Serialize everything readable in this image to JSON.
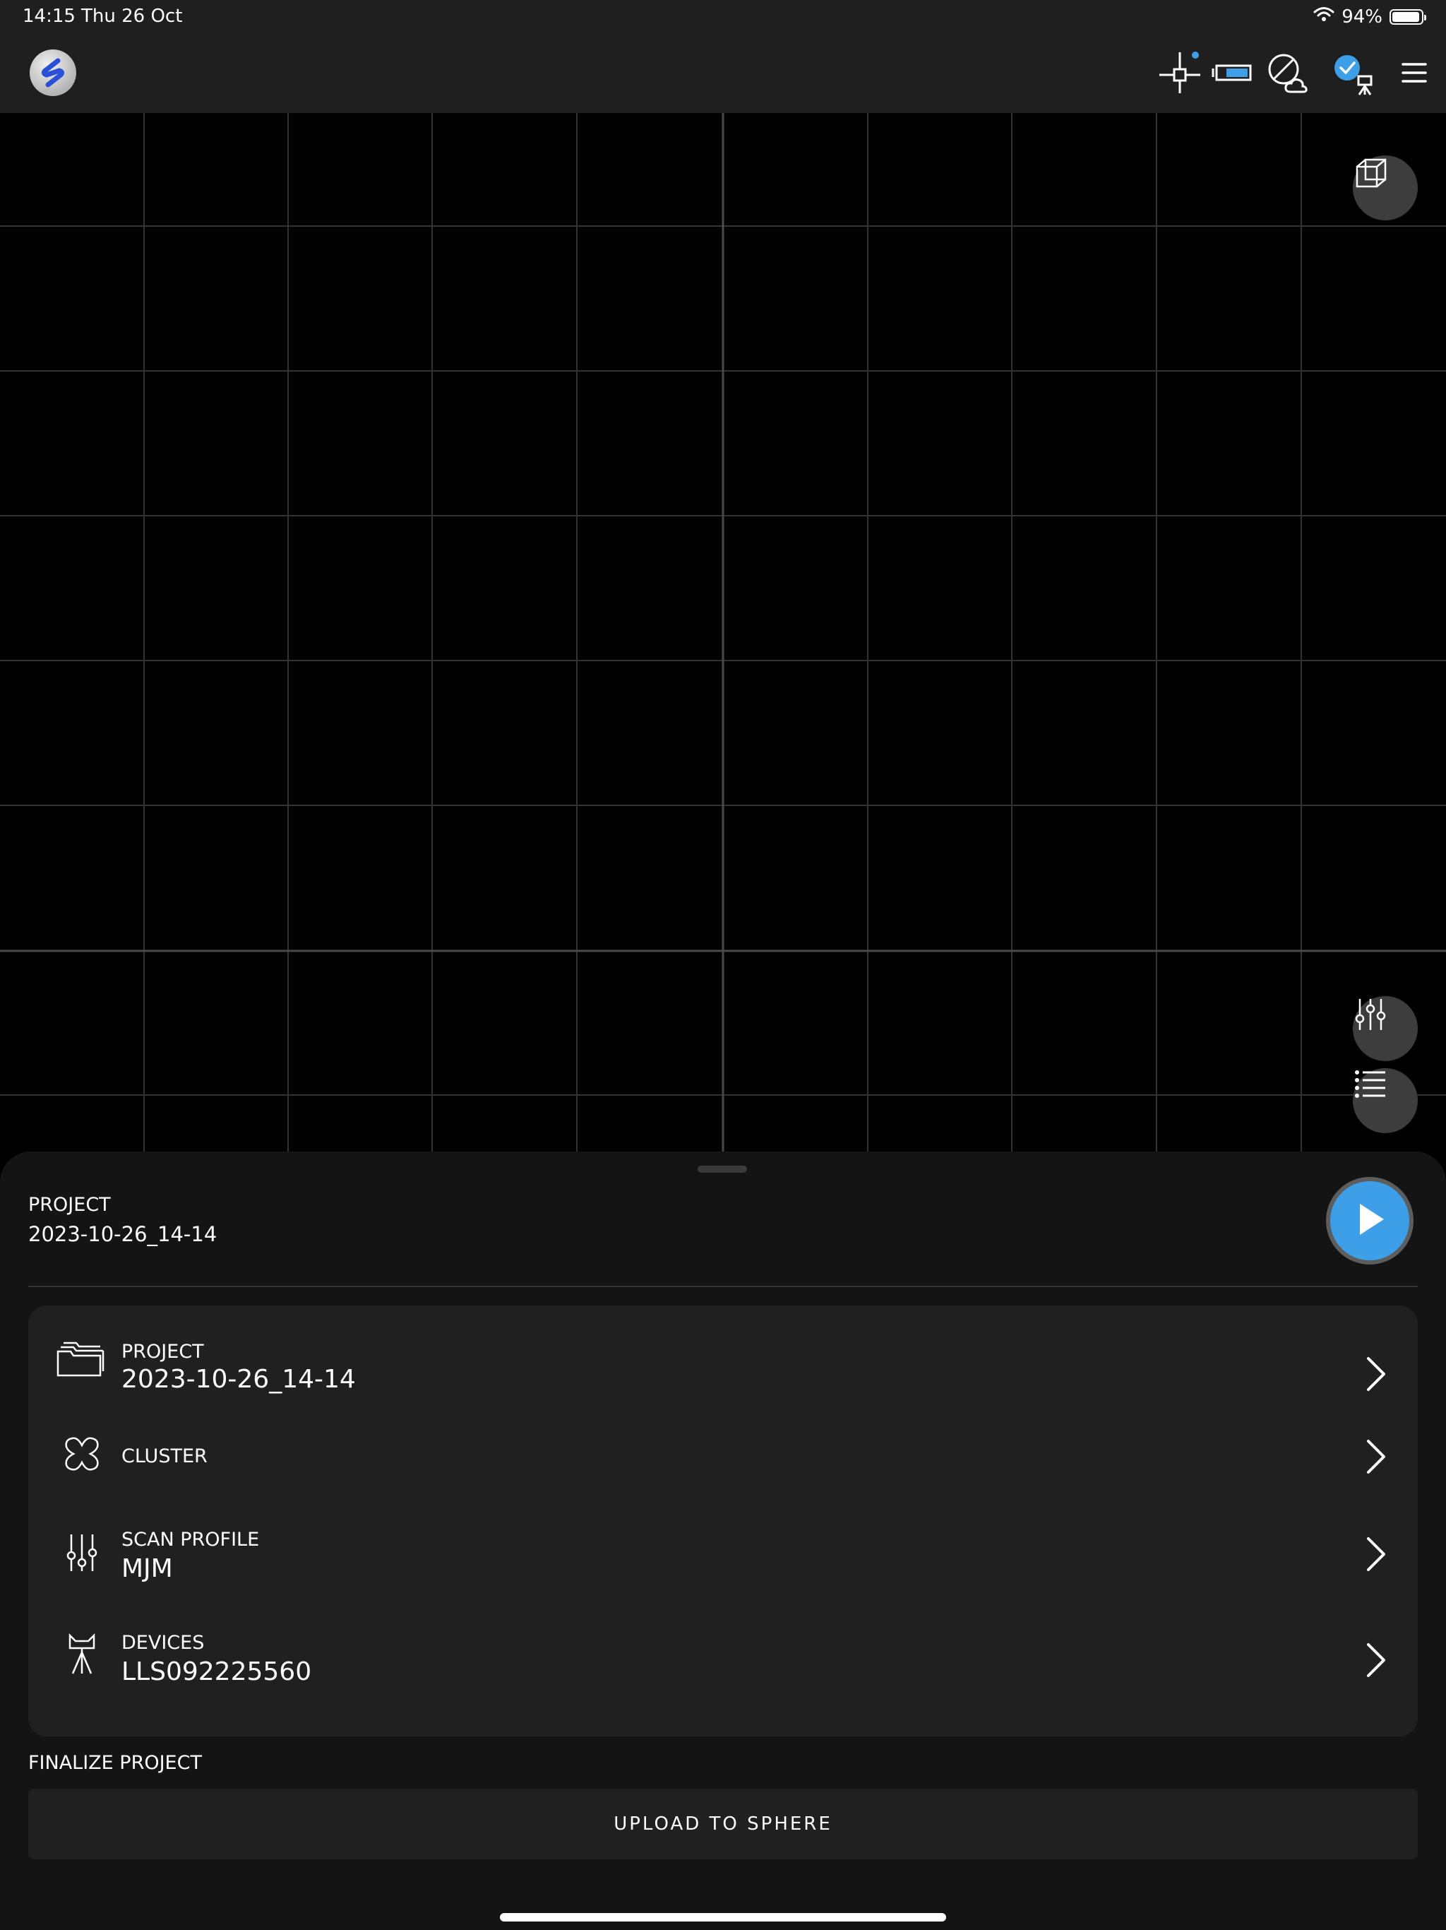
{
  "status_bar": {
    "time": "14:15",
    "date": "Thu 26 Oct",
    "battery": "94%",
    "battery_level": 0.94
  },
  "toolbar": {
    "icons": [
      "app-logo-icon",
      "crosshair-icon",
      "battery-indicator-icon",
      "cloud-disabled-icon",
      "scanner-connected-icon",
      "hamburger-menu-icon"
    ]
  },
  "viewport": {
    "buttons": [
      "cube-view-icon",
      "filter-sliders-icon",
      "list-icon"
    ]
  },
  "sheet": {
    "project_label": "PROJECT",
    "project_value": "2023-10-26_14-14",
    "rows": [
      {
        "label": "PROJECT",
        "value": "2023-10-26_14-14",
        "icon": "folders-icon"
      },
      {
        "label": "CLUSTER",
        "value": "",
        "icon": "cluster-icon"
      },
      {
        "label": "SCAN PROFILE",
        "value": "MJM",
        "icon": "sliders-icon"
      },
      {
        "label": "DEVICES",
        "value": "LLS092225560",
        "icon": "scanner-device-icon"
      }
    ],
    "finalize_label": "FINALIZE PROJECT",
    "upload_label": "UPLOAD TO SPHERE"
  },
  "colors": {
    "accent": "#3d9fe8",
    "background": "#000000",
    "panel": "#141414",
    "card": "#202020"
  }
}
